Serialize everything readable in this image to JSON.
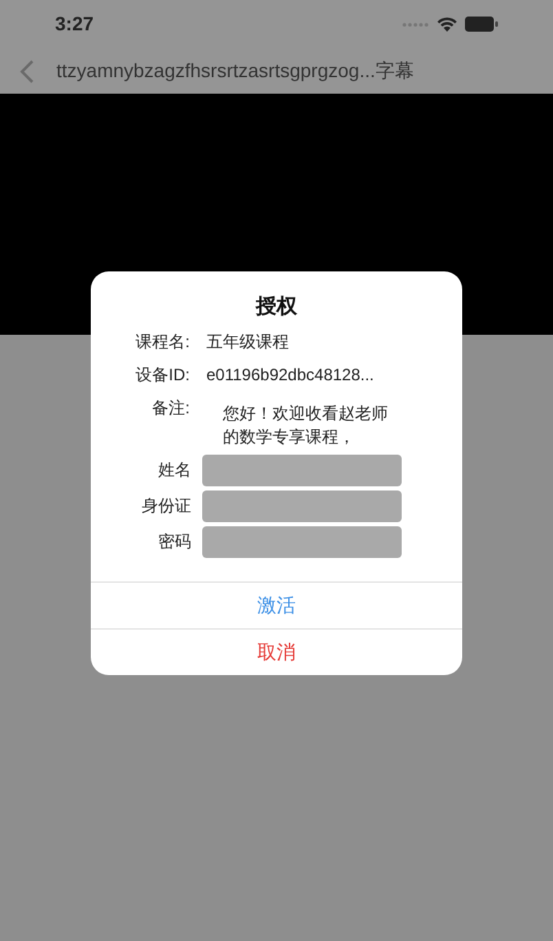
{
  "status_bar": {
    "time": "3:27"
  },
  "nav_bar": {
    "title": "ttzyamnybzagzfhsrsrtzasrtsgprgzog...字幕"
  },
  "dialog": {
    "title": "授权",
    "info": [
      {
        "label": "课程名:",
        "value": "五年级课程"
      },
      {
        "label": "设备ID:",
        "value": "e01196b92dbc48128..."
      },
      {
        "label": "备注:",
        "value": "您好！欢迎收看赵老师的数学专享课程，"
      }
    ],
    "fields": [
      {
        "label": "姓名"
      },
      {
        "label": "身份证"
      },
      {
        "label": "密码"
      }
    ],
    "buttons": [
      {
        "label": "激活",
        "kind": "primary"
      },
      {
        "label": "取消",
        "kind": "cancel"
      }
    ]
  }
}
